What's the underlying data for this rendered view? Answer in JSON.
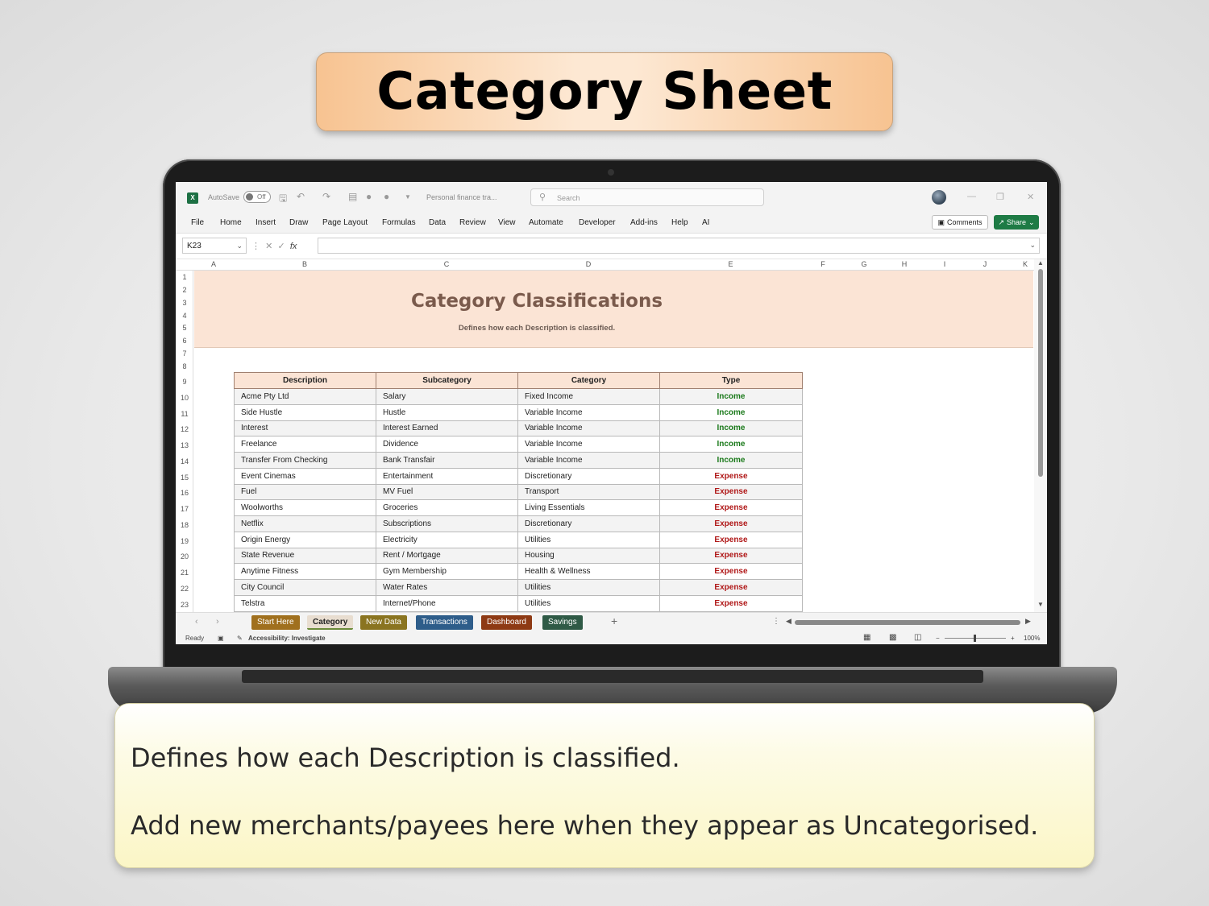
{
  "header": {
    "title": "Category Sheet"
  },
  "window": {
    "autosave_label": "AutoSave",
    "autosave_state": "Off",
    "file_name": "Personal finance tra...",
    "search_placeholder": "Search",
    "app_icon_label": "X"
  },
  "menu": {
    "items": [
      "File",
      "Home",
      "Insert",
      "Draw",
      "Page Layout",
      "Formulas",
      "Data",
      "Review",
      "View",
      "Automate",
      "Developer",
      "Add-ins",
      "Help",
      "AI"
    ],
    "comments_label": "Comments",
    "share_label": "Share"
  },
  "formula_bar": {
    "cell_ref": "K23",
    "formula": "",
    "fx_label": "fx"
  },
  "grid": {
    "columns": [
      "A",
      "B",
      "C",
      "D",
      "E",
      "F",
      "G",
      "H",
      "I",
      "J",
      "K"
    ],
    "rows": [
      "1",
      "2",
      "3",
      "4",
      "5",
      "6",
      "7",
      "8",
      "9",
      "10",
      "11",
      "12",
      "13",
      "14",
      "15",
      "16",
      "17",
      "18",
      "19",
      "20",
      "21",
      "22",
      "23"
    ]
  },
  "sheet": {
    "banner_title": "Category Classifications",
    "banner_subtitle": "Defines how each Description is classified.",
    "table": {
      "headers": [
        "Description",
        "Subcategory",
        "Category",
        "Type"
      ],
      "rows": [
        [
          "Acme Pty Ltd",
          "Salary",
          "Fixed Income",
          "Income"
        ],
        [
          "Side Hustle",
          "Hustle",
          "Variable Income",
          "Income"
        ],
        [
          "Interest",
          "Interest Earned",
          "Variable Income",
          "Income"
        ],
        [
          "Freelance",
          "Dividence",
          "Variable Income",
          "Income"
        ],
        [
          "Transfer From Checking",
          "Bank Transfair",
          "Variable Income",
          "Income"
        ],
        [
          "Event Cinemas",
          "Entertainment",
          "Discretionary",
          "Expense"
        ],
        [
          "Fuel",
          "MV Fuel",
          "Transport",
          "Expense"
        ],
        [
          "Woolworths",
          "Groceries",
          "Living Essentials",
          "Expense"
        ],
        [
          "Netflix",
          "Subscriptions",
          "Discretionary",
          "Expense"
        ],
        [
          "Origin Energy",
          "Electricity",
          "Utilities",
          "Expense"
        ],
        [
          "State Revenue",
          "Rent / Mortgage",
          "Housing",
          "Expense"
        ],
        [
          "Anytime Fitness",
          "Gym Membership",
          "Health & Wellness",
          "Expense"
        ],
        [
          "City Council",
          "Water Rates",
          "Utilities",
          "Expense"
        ],
        [
          "Telstra",
          "Internet/Phone",
          "Utilities",
          "Expense"
        ]
      ]
    }
  },
  "tabs": [
    {
      "label": "Start Here",
      "color": "#a0701e",
      "active": false
    },
    {
      "label": "Category",
      "color": "#e8ddd0",
      "active": true
    },
    {
      "label": "New Data",
      "color": "#8a7420",
      "active": false
    },
    {
      "label": "Transactions",
      "color": "#2e5d8a",
      "active": false
    },
    {
      "label": "Dashboard",
      "color": "#8e3a14",
      "active": false
    },
    {
      "label": "Savings",
      "color": "#2f5a46",
      "active": false
    }
  ],
  "status": {
    "ready": "Ready",
    "accessibility": "Accessibility: Investigate",
    "zoom": "100%"
  },
  "colors": {
    "income": "#1b7a1b",
    "expense": "#b01818",
    "banner": "#fbe4d5",
    "share": "#1e7b45"
  },
  "callout": {
    "line1": "Defines how each Description is classified.",
    "line2": "Add new merchants/payees here when they appear as Uncategorised."
  }
}
